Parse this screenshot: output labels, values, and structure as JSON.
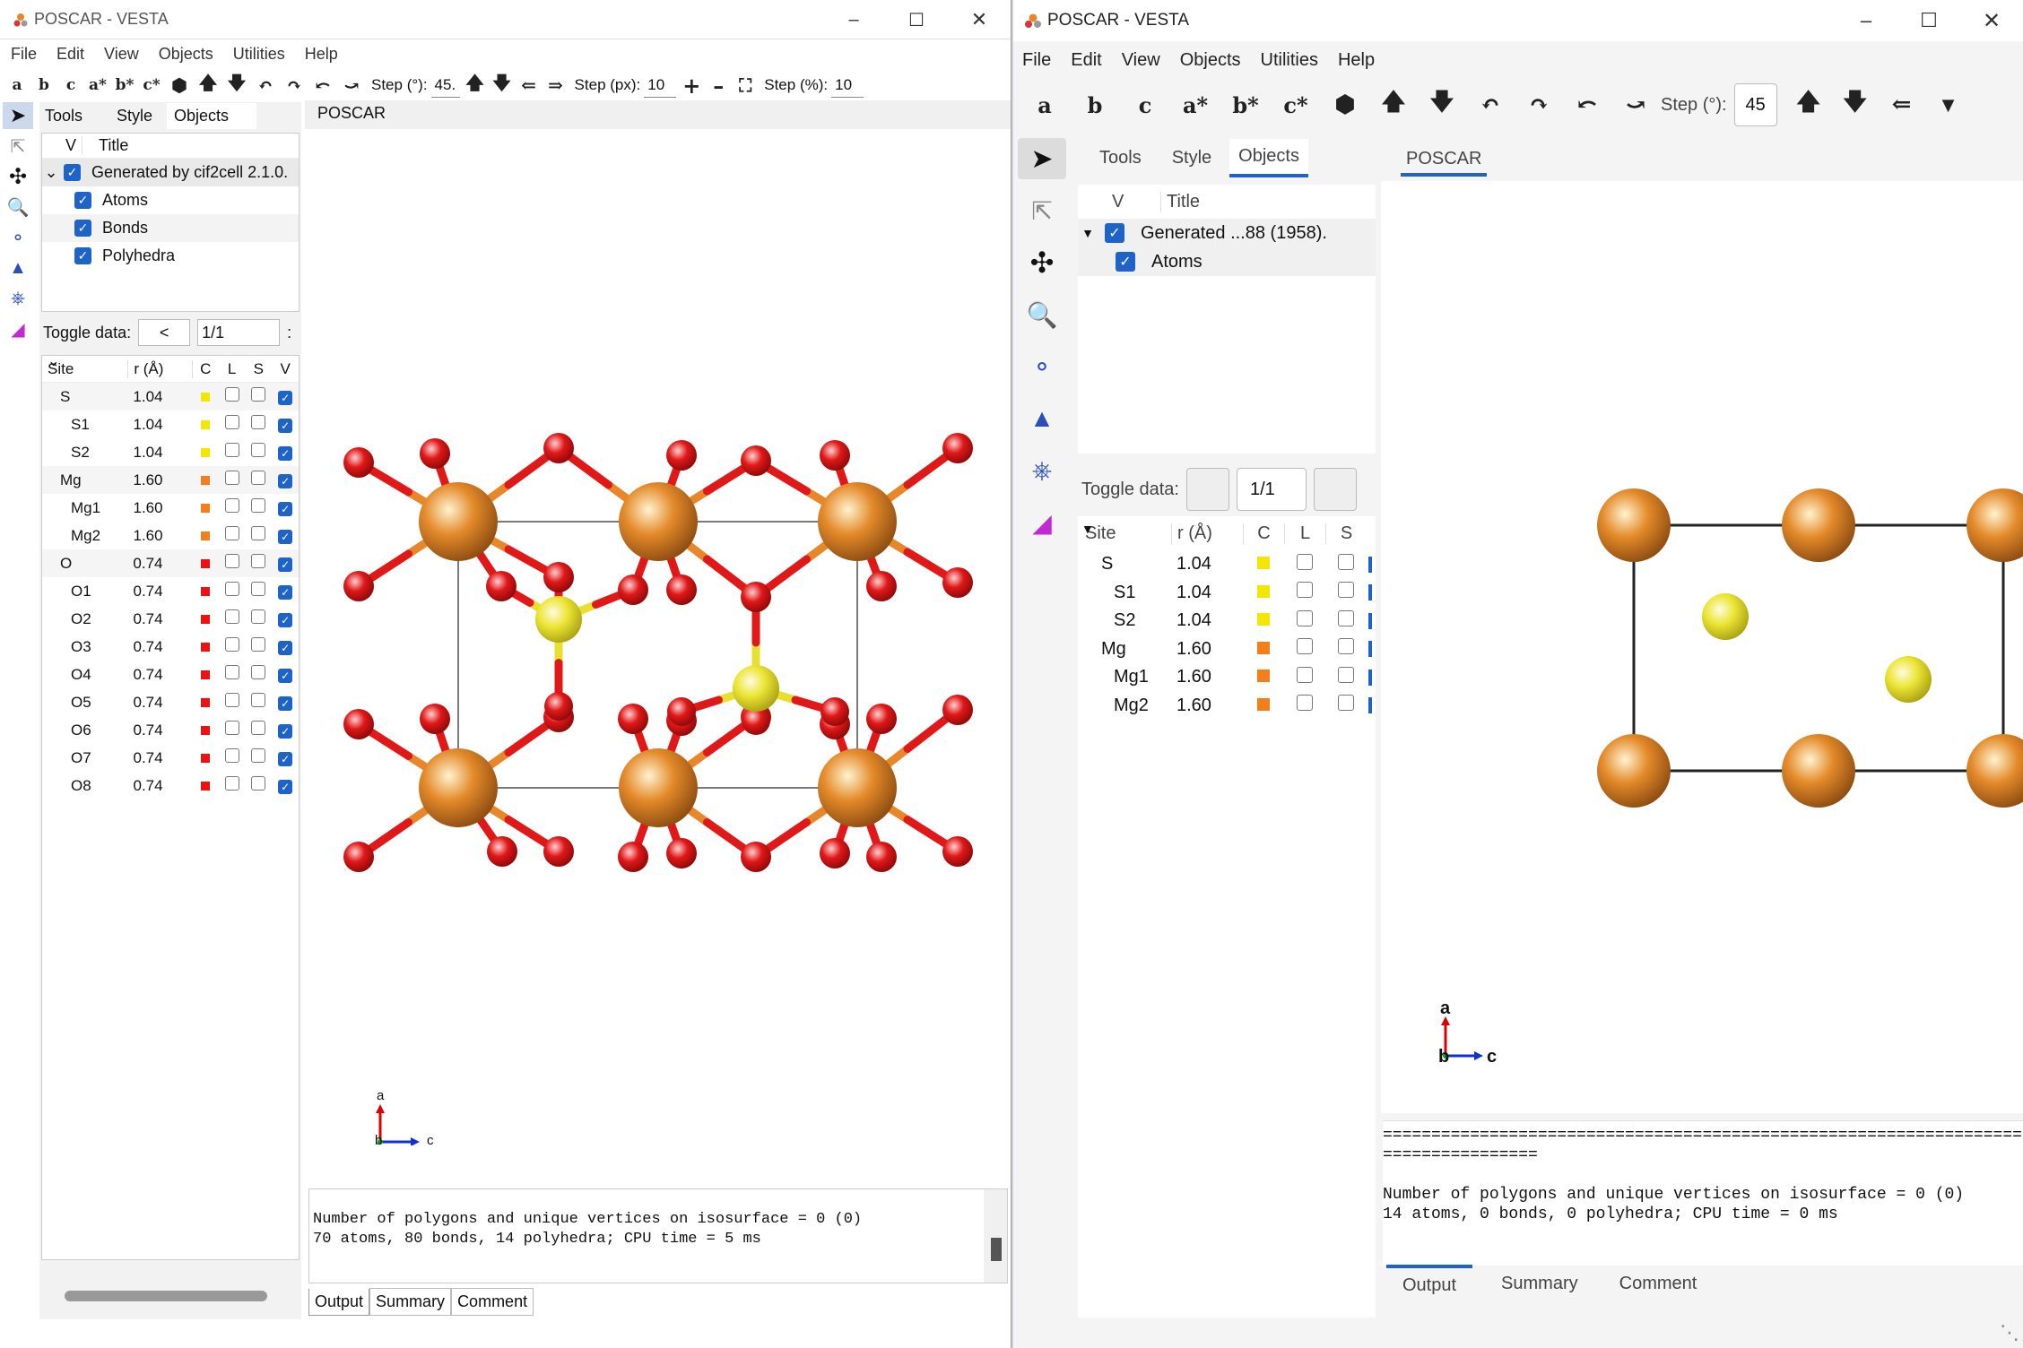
{
  "left": {
    "title": "POSCAR - VESTA",
    "menu": [
      "File",
      "Edit",
      "View",
      "Objects",
      "Utilities",
      "Help"
    ],
    "tb_axes": [
      "a",
      "b",
      "c",
      "a*",
      "b*",
      "c*"
    ],
    "step_deg_label": "Step (°):",
    "step_deg_value": "45.",
    "step_px_label": "Step (px):",
    "step_px_value": "10",
    "step_pct_label": "Step (%):",
    "step_pct_value": "10",
    "panel_tabs": [
      "Tools",
      "Style",
      "Objects"
    ],
    "view_tab": "POSCAR",
    "obj_head": {
      "v": "V",
      "title": "Title"
    },
    "objects": [
      "Generated by cif2cell 2.1.0.",
      "Atoms",
      "Bonds",
      "Polyhedra"
    ],
    "toggle_label": "Toggle data:",
    "toggle_prev": "<",
    "toggle_value": "1/1",
    "toggle_more": ":",
    "site_head": {
      "site": "Site",
      "r": "r (Å)",
      "c": "C",
      "l": "L",
      "s": "S",
      "v": "V"
    },
    "sites": [
      {
        "name": "S",
        "r": "1.04",
        "group": true,
        "color": "#f5e600"
      },
      {
        "name": "S1",
        "r": "1.04",
        "group": false,
        "color": "#f5e600"
      },
      {
        "name": "S2",
        "r": "1.04",
        "group": false,
        "color": "#f5e600"
      },
      {
        "name": "Mg",
        "r": "1.60",
        "group": true,
        "color": "#f47e1a"
      },
      {
        "name": "Mg1",
        "r": "1.60",
        "group": false,
        "color": "#f47e1a"
      },
      {
        "name": "Mg2",
        "r": "1.60",
        "group": false,
        "color": "#f47e1a"
      },
      {
        "name": "O",
        "r": "0.74",
        "group": true,
        "color": "#ee1111"
      },
      {
        "name": "O1",
        "r": "0.74",
        "group": false,
        "color": "#ee1111"
      },
      {
        "name": "O2",
        "r": "0.74",
        "group": false,
        "color": "#ee1111"
      },
      {
        "name": "O3",
        "r": "0.74",
        "group": false,
        "color": "#ee1111"
      },
      {
        "name": "O4",
        "r": "0.74",
        "group": false,
        "color": "#ee1111"
      },
      {
        "name": "O5",
        "r": "0.74",
        "group": false,
        "color": "#ee1111"
      },
      {
        "name": "O6",
        "r": "0.74",
        "group": false,
        "color": "#ee1111"
      },
      {
        "name": "O7",
        "r": "0.74",
        "group": false,
        "color": "#ee1111"
      },
      {
        "name": "O8",
        "r": "0.74",
        "group": false,
        "color": "#ee1111"
      }
    ],
    "output_line1": "Number of polygons and unique vertices on isosurface = 0 (0)",
    "output_line2": "70 atoms, 80 bonds, 14 polyhedra; CPU time = 5 ms",
    "bottom_tabs": [
      "Output",
      "Summary",
      "Comment"
    ],
    "axis_a": "a",
    "axis_b": "b",
    "axis_c": "c"
  },
  "right": {
    "title": "POSCAR - VESTA",
    "menu": [
      "File",
      "Edit",
      "View",
      "Objects",
      "Utilities",
      "Help"
    ],
    "tb_axes": [
      "a",
      "b",
      "c",
      "a*",
      "b*",
      "c*"
    ],
    "step_deg_label": "Step (°):",
    "step_deg_value": "45",
    "panel_tabs": [
      "Tools",
      "Style",
      "Objects"
    ],
    "view_tab": "POSCAR",
    "obj_head": {
      "v": "V",
      "title": "Title"
    },
    "objects": [
      "Generated ...88 (1958).",
      "Atoms"
    ],
    "toggle_label": "Toggle data:",
    "toggle_value": "1/1",
    "site_head": {
      "site": "Site",
      "r": "r (Å)",
      "c": "C",
      "l": "L",
      "s": "S"
    },
    "sites": [
      {
        "name": "S",
        "r": "1.04",
        "group": true,
        "color": "#f5e600"
      },
      {
        "name": "S1",
        "r": "1.04",
        "group": false,
        "color": "#f5e600"
      },
      {
        "name": "S2",
        "r": "1.04",
        "group": false,
        "color": "#f5e600"
      },
      {
        "name": "Mg",
        "r": "1.60",
        "group": true,
        "color": "#f47e1a"
      },
      {
        "name": "Mg1",
        "r": "1.60",
        "group": false,
        "color": "#f47e1a"
      },
      {
        "name": "Mg2",
        "r": "1.60",
        "group": false,
        "color": "#f47e1a"
      }
    ],
    "output_sep1": "==================================================================",
    "output_sep2": "================",
    "output_line1": "Number of polygons and unique vertices on isosurface = 0 (0)",
    "output_line2": "14 atoms, 0 bonds, 0 polyhedra; CPU time = 0 ms",
    "bottom_tabs": [
      "Output",
      "Summary",
      "Comment"
    ],
    "axis_a": "a",
    "axis_b": "b",
    "axis_c": "c"
  },
  "colors": {
    "accent": "#1e63c8",
    "mg": "#e0781c",
    "s": "#f0e630",
    "o": "#e01010"
  }
}
